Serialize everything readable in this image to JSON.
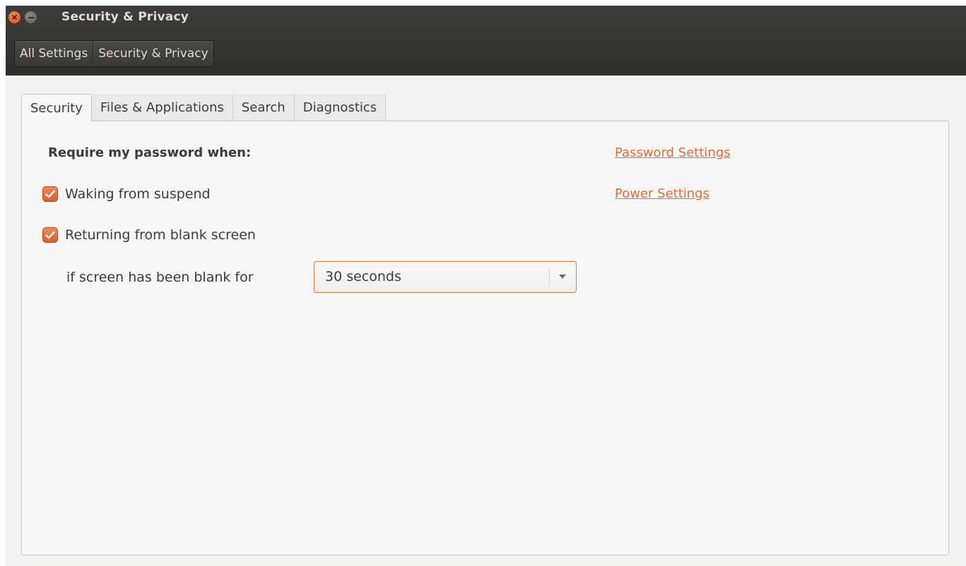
{
  "window": {
    "title": "Security & Privacy"
  },
  "breadcrumb": {
    "items": [
      {
        "label": "All Settings"
      },
      {
        "label": "Security & Privacy"
      }
    ]
  },
  "tabs": [
    {
      "label": "Security",
      "active": true
    },
    {
      "label": "Files & Applications",
      "active": false
    },
    {
      "label": "Search",
      "active": false
    },
    {
      "label": "Diagnostics",
      "active": false
    }
  ],
  "security": {
    "require_label": "Require my password when:",
    "waking": {
      "label": "Waking from suspend",
      "checked": true
    },
    "returning": {
      "label": "Returning from blank screen",
      "checked": true
    },
    "blank_for_label": "if screen has been blank for",
    "blank_for_value": "30 seconds",
    "links": {
      "password": "Password Settings",
      "power": "Power Settings"
    }
  },
  "colors": {
    "accent": "#e16b3c",
    "header_bg": "#3e3d39",
    "window_bg": "#f2f1f0"
  },
  "icons": {
    "close": "close-icon",
    "minimize": "minimize-icon",
    "check": "checkmark-icon",
    "dropdown": "chevron-down-icon"
  }
}
